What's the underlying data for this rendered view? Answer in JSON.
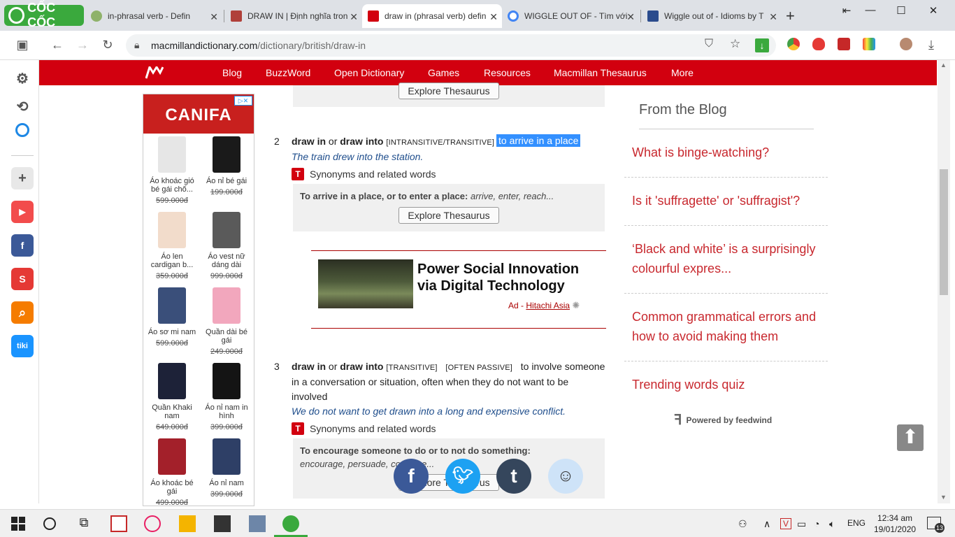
{
  "browser": {
    "brand": "CỐC CỐC",
    "tabs": [
      {
        "title": "in-phrasal verb - Defin"
      },
      {
        "title": "DRAW IN | Định nghĩa tron"
      },
      {
        "title": "draw in (phrasal verb) defin"
      },
      {
        "title": "WIGGLE OUT OF - Tìm với G"
      },
      {
        "title": "Wiggle out of - Idioms by T"
      }
    ],
    "url_main": "macmillandictionary.com",
    "url_path": "/dictionary/british/draw-in"
  },
  "nav": {
    "items": [
      "Blog",
      "BuzzWord",
      "Open Dictionary",
      "Games",
      "Resources",
      "Macmillan Thesaurus",
      "More"
    ]
  },
  "ad_left": {
    "brand": "CANIFA",
    "products": [
      {
        "name": "Áo khoác gió bé gái chố...",
        "price": "599.000đ",
        "color": "#e6e6e6"
      },
      {
        "name": "Áo nỉ bé gái",
        "price": "199.000đ",
        "color": "#1a1a1a"
      },
      {
        "name": "Áo len cardigan b...",
        "price": "359.000đ",
        "color": "#f2dccb"
      },
      {
        "name": "Áo vest nữ dáng dài",
        "price": "999.000đ",
        "color": "#5a5a5a"
      },
      {
        "name": "Áo sơ mi nam",
        "price": "599.000đ",
        "color": "#3a4f7a"
      },
      {
        "name": "Quần dài bé gái",
        "price": "249.000đ",
        "color": "#f2a7bd"
      },
      {
        "name": "Quần Khaki nam",
        "price": "649.000đ",
        "color": "#1d2238"
      },
      {
        "name": "Áo nỉ nam in hình",
        "price": "399.000đ",
        "color": "#141414"
      },
      {
        "name": "Áo khoác bé gái",
        "price": "499.000đ",
        "color": "#a3202a"
      },
      {
        "name": "Áo nỉ nam",
        "price": "399.000đ",
        "color": "#2e3f66"
      }
    ]
  },
  "thesaurus_button": "Explore Thesaurus",
  "synonyms_label": "Synonyms and related words",
  "sense2": {
    "num": "2",
    "hw1": "draw in",
    "or": "or",
    "hw2": "draw into",
    "gram": "[INTRANSITIVE/TRANSITIVE]",
    "def": "to arrive in a place",
    "example": "The train drew into the station.",
    "thes_lead": "To arrive in a place, or to enter a place:",
    "thes_words": "arrive, enter, reach..."
  },
  "ad_mid": {
    "headline": "Power Social Innovation via Digital Technology",
    "ad_label": "Ad -",
    "advertiser": "Hitachi Asia"
  },
  "sense3": {
    "num": "3",
    "hw1": "draw in",
    "or": "or",
    "hw2": "draw into",
    "gram1": "[TRANSITIVE]",
    "gram2": "[OFTEN PASSIVE]",
    "def_l1": "to involve someone",
    "def_l2": "in a conversation or situation, often when they do not want to be",
    "def_l3": "involved",
    "example": "We do not want to get drawn into a long and expensive conflict.",
    "thes_lead": "To encourage someone to do or to not do something:",
    "thes_words": "encourage, persuade, convince..."
  },
  "blog": {
    "title": "From the Blog",
    "items": [
      "What is binge-watching?",
      "Is it 'suffragette' or 'suffragist'?",
      "‘Black and white’ is a surprisingly colourful expres...",
      "Common grammatical errors and how to avoid making them",
      "Trending words quiz"
    ],
    "powered": "Powered by feedwind"
  },
  "taskbar": {
    "lang": "ENG",
    "time": "12:34 am",
    "date": "19/01/2020",
    "notif": "13"
  }
}
